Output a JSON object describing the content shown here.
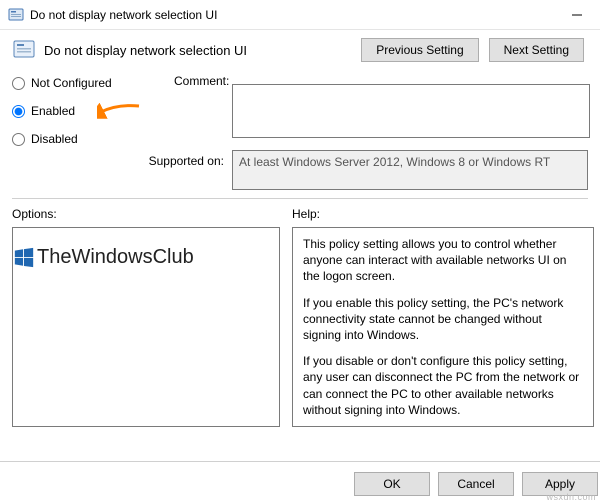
{
  "titlebar": {
    "title": "Do not display network selection UI"
  },
  "header": {
    "title": "Do not display network selection UI",
    "prev": "Previous Setting",
    "next": "Next Setting"
  },
  "radios": {
    "not_configured": "Not Configured",
    "enabled": "Enabled",
    "disabled": "Disabled"
  },
  "labels": {
    "comment": "Comment:",
    "supported_on": "Supported on:",
    "options": "Options:",
    "help": "Help:"
  },
  "supported_text": "At least Windows Server 2012, Windows 8 or Windows RT",
  "watermark": "TheWindowsClub",
  "help": {
    "p1": "This policy setting allows you to control whether anyone can interact with available networks UI on the logon screen.",
    "p2": "If you enable this policy setting, the PC's network connectivity state cannot be changed without signing into Windows.",
    "p3": "If you disable or don't configure this policy setting, any user can disconnect the PC from the network or can connect the PC to other available networks without signing into Windows."
  },
  "footer": {
    "ok": "OK",
    "cancel": "Cancel",
    "apply": "Apply"
  },
  "corner_wm": "wsxdn.com"
}
